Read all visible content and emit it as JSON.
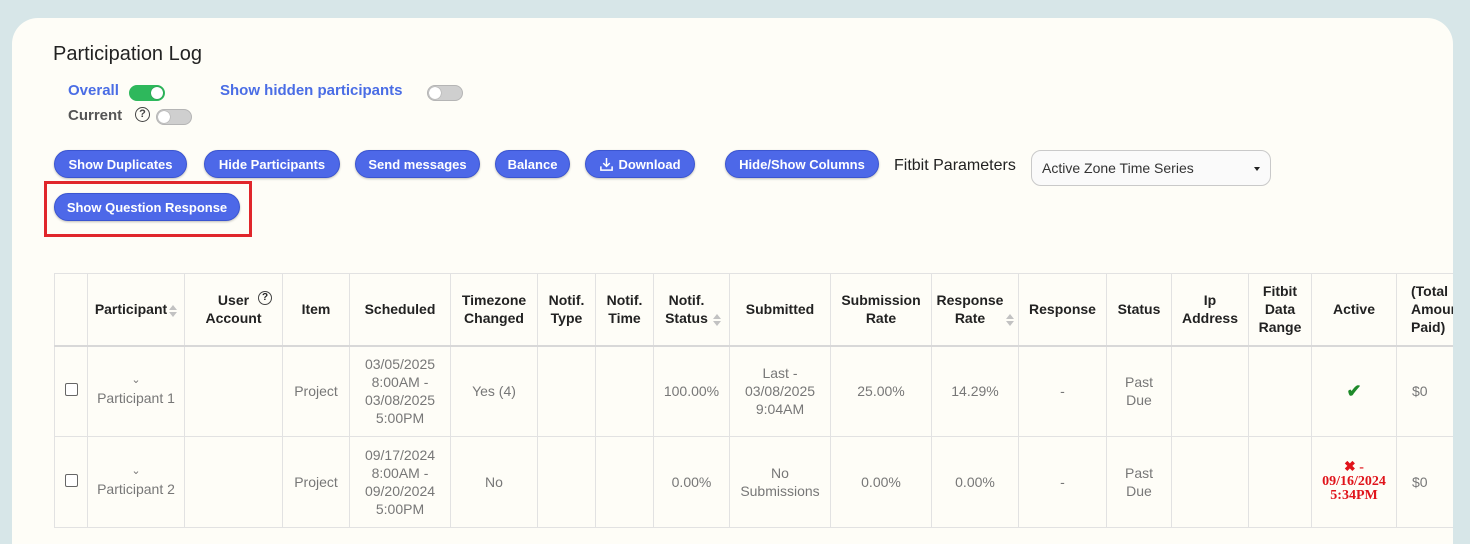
{
  "page": {
    "title": "Participation Log"
  },
  "toggles": {
    "overall_label": "Overall",
    "overall_on": true,
    "current_label": "Current",
    "current_on": false,
    "hidden_label": "Show hidden participants",
    "hidden_on": false,
    "help_glyph": "?"
  },
  "toolbar": {
    "show_duplicates": "Show Duplicates",
    "hide_participants": "Hide Participants",
    "send_messages": "Send messages",
    "balance": "Balance",
    "download": "Download",
    "hide_show_columns": "Hide/Show Columns",
    "show_question_response": "Show Question Response",
    "fitbit_label": "Fitbit Parameters",
    "fitbit_selected": "Active Zone Time Series"
  },
  "table": {
    "headers": {
      "participant": "Participant",
      "user_account": "User Account",
      "item": "Item",
      "scheduled": "Scheduled",
      "timezone_changed": "Timezone Changed",
      "notif_type": "Notif. Type",
      "notif_time": "Notif. Time",
      "notif_status": "Notif. Status",
      "submitted": "Submitted",
      "submission_rate": "Submission Rate",
      "response_rate": "Response Rate",
      "response": "Response",
      "status": "Status",
      "ip_address": "Ip Address",
      "fitbit_data_range": "Fitbit Data Range",
      "active": "Active",
      "total_amount_paid": "(Total Amount Paid)"
    },
    "rows": [
      {
        "chevron": "⌄",
        "participant": "Participant 1",
        "user_account": "",
        "item": "Project",
        "scheduled": "03/05/2025 8:00AM - 03/08/2025 5:00PM",
        "timezone_changed": "Yes (4)",
        "notif_type": "",
        "notif_time": "",
        "notif_status": "100.00%",
        "submitted": "Last - 03/08/2025 9:04AM",
        "submission_rate": "25.00%",
        "response_rate": "14.29%",
        "response": "-",
        "status": "Past Due",
        "ip_address": "",
        "fitbit_data_range": "",
        "active_mark": "✔",
        "active_text": "",
        "total_paid": "$0"
      },
      {
        "chevron": "⌄",
        "participant": "Participant 2",
        "user_account": "",
        "item": "Project",
        "scheduled": "09/17/2024 8:00AM - 09/20/2024 5:00PM",
        "timezone_changed": "No",
        "notif_type": "",
        "notif_time": "",
        "notif_status": "0.00%",
        "submitted": "No Submissions",
        "submission_rate": "0.00%",
        "response_rate": "0.00%",
        "response": "-",
        "status": "Past Due",
        "ip_address": "",
        "fitbit_data_range": "",
        "active_mark": "✖",
        "active_text": " - 09/16/2024 5:34PM",
        "total_paid": "$0"
      }
    ]
  },
  "colors": {
    "accent": "#4d68e8",
    "highlight": "#e0262b",
    "toggle_on": "#2eb85c"
  }
}
